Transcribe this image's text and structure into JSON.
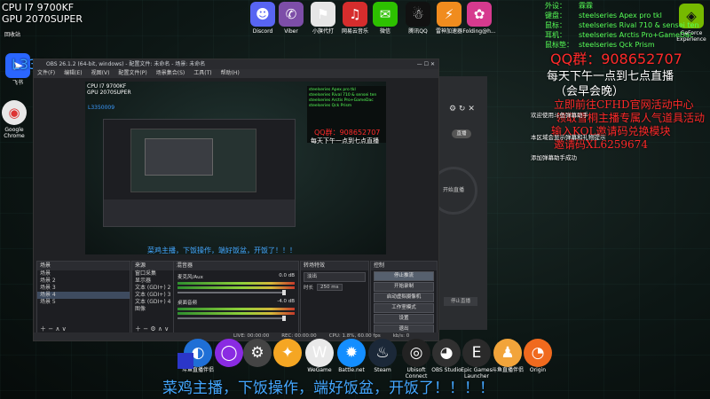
{
  "hud_topleft": {
    "cpu": "CPU I7 9700KF",
    "gpu": "GPU 2070SUPER",
    "bin": "回收站"
  },
  "desktop_icons_top": [
    {
      "name": "Discord",
      "label": "Discord",
      "color": "#5865f2",
      "glyph": "☻"
    },
    {
      "name": "Viber",
      "label": "Viber",
      "color": "#7d4ea8",
      "glyph": "✆"
    },
    {
      "name": "Xiaohongshu",
      "label": "小旗代打",
      "color": "#e6e6e6",
      "glyph": "⚑"
    },
    {
      "name": "NetEase",
      "label": "网易云音乐",
      "color": "#d62d2d",
      "glyph": "♫"
    },
    {
      "name": "WeChat",
      "label": "微信",
      "color": "#2dc100",
      "glyph": "✉"
    },
    {
      "name": "QQ",
      "label": "腾讯QQ",
      "color": "#111",
      "glyph": "☃"
    },
    {
      "name": "Thunder",
      "label": "雷神加速器",
      "color": "#f08c1e",
      "glyph": "⚡"
    },
    {
      "name": "Folding",
      "label": "Folding@h...",
      "color": "#d63a8e",
      "glyph": "✿"
    }
  ],
  "desktop_icons_left": [
    {
      "name": "FeiShu",
      "label": "飞书",
      "color": "#2a66ff",
      "glyph": "➤"
    },
    {
      "name": "Chrome",
      "label": "Google Chrome",
      "color": "#e8e8e8",
      "glyph": "◉"
    }
  ],
  "left_overlay_number": "L3350009",
  "nvidia": {
    "label": "GeForce Experience"
  },
  "peripherals": [
    {
      "k": "外设：",
      "v": "霖霖"
    },
    {
      "k": "键盘：",
      "v": "steelseries Apex pro tkl"
    },
    {
      "k": "鼠标：",
      "v": "steelseries Rival 710 & sensei ten"
    },
    {
      "k": "耳机：",
      "v": "steelseries Arctis Pro+GameDac"
    },
    {
      "k": "鼠标垫：",
      "v": "steelseries Qck Prism"
    }
  ],
  "qq_group": "QQ群：908652707",
  "stream_time": "每天下午一点到七点直播",
  "stream_note": "（会早会晚）",
  "promo_lines": [
    "立即前往CFHD官网活动中心",
    "领取雪桐主播专属人气道具活动",
    "输入KOL邀请码兑换模块",
    "邀请码XL6259674"
  ],
  "chat_lines": [
    "欢迎使用斗鱼弹幕助手",
    "本区域会显示弹幕和礼物提示",
    "添加弹幕助手成功"
  ],
  "obs": {
    "title": "OBS 26.1.2 (64-bit, windows) - 配置文件: 未命名 - 场景: 未命名",
    "menu": [
      "文件(F)",
      "编辑(E)",
      "视图(V)",
      "配置文件(P)",
      "场景集合(S)",
      "工具(T)",
      "帮助(H)"
    ],
    "preview_caption": "菜鸡主播，下饭操作，端好饭盆，开饭了！！！",
    "scenes_header": "场景",
    "scenes": [
      "场景",
      "场景 2",
      "场景 3",
      "场景 4",
      "场景 5"
    ],
    "sources_header": "来源",
    "sources": [
      "窗口采集",
      "显示器",
      "文本 (GDI+) 2",
      "文本 (GDI+) 3",
      "文本 (GDI+) 4",
      "图像"
    ],
    "mixer_header": "混音器",
    "mixer": [
      {
        "label": "麦克风/Aux",
        "db": "0.0 dB"
      },
      {
        "label": "桌面音频",
        "db": "-4.0 dB"
      }
    ],
    "transition_header": "转场特效",
    "transition_value": "淡出",
    "duration_label": "时长",
    "duration_value": "250 ms",
    "controls_header": "控制",
    "controls": [
      "停止推流",
      "开始录制",
      "启动虚拟摄像机",
      "工作室模式",
      "设置",
      "退出"
    ],
    "status": [
      "LIVE: 00:00:00",
      "REC: 00:00:00",
      "CPU: 1.8%, 60.00 fps",
      "kb/s: 0"
    ]
  },
  "sidepanel": {
    "btn": "直播",
    "label1": "开始直播",
    "label2": "停止直播"
  },
  "taskbar_icons": [
    {
      "name": "DouyuHelper",
      "label": "斗鱼直播伴侣",
      "color": "#1f6fd6",
      "glyph": "◐"
    },
    {
      "name": "Overwolf",
      "label": "",
      "color": "#8a2be2",
      "glyph": "◯"
    },
    {
      "name": "GearApp",
      "label": "",
      "color": "#444",
      "glyph": "⚙"
    },
    {
      "name": "Fox",
      "label": "",
      "color": "#f5a623",
      "glyph": "✦"
    },
    {
      "name": "WeGame",
      "label": "WeGame",
      "color": "#e9e9e9",
      "glyph": "W"
    },
    {
      "name": "Battlenet",
      "label": "Battle.net",
      "color": "#148eff",
      "glyph": "✹"
    },
    {
      "name": "Steam",
      "label": "Steam",
      "color": "#1b2838",
      "glyph": "♨"
    },
    {
      "name": "Ubisoft",
      "label": "Ubisoft Connect",
      "color": "#222",
      "glyph": "◎"
    },
    {
      "name": "OBS",
      "label": "OBS Studio",
      "color": "#303030",
      "glyph": "◕"
    },
    {
      "name": "Epic",
      "label": "Epic Games Launcher",
      "color": "#2a2a2a",
      "glyph": "E"
    },
    {
      "name": "Douyu",
      "label": "斗鱼直播伴侣",
      "color": "#f2a43a",
      "glyph": "♟"
    },
    {
      "name": "Origin",
      "label": "Origin",
      "color": "#f06a1e",
      "glyph": "◔"
    }
  ],
  "bottom_caption": "菜鸡主播，下饭操作，端好饭盆，开饭了！！！！"
}
